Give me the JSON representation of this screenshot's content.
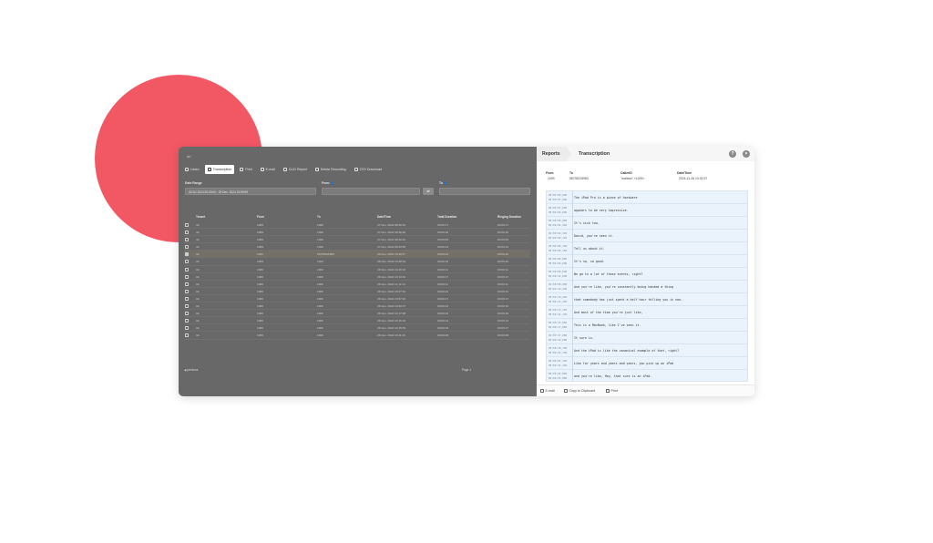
{
  "colors": {
    "accent_circle": "#f25764",
    "main_bg": "#686868",
    "panel_bg": "#ffffff",
    "transcript_bg": "#eaf3fb"
  },
  "breadcrumb": "Ar/",
  "toolbar": [
    {
      "label": "Listen",
      "icon": "headphones-icon",
      "active": false
    },
    {
      "label": "Transcription",
      "icon": "document-icon",
      "active": true
    },
    {
      "label": "Print",
      "icon": "printer-icon",
      "active": false
    },
    {
      "label": "E-mail",
      "icon": "mail-icon",
      "active": false
    },
    {
      "label": "CLID Report",
      "icon": "report-icon",
      "active": false
    },
    {
      "label": "Delete Recording",
      "icon": "trash-icon",
      "active": false
    },
    {
      "label": "CSV Download",
      "icon": "download-icon",
      "active": false
    }
  ],
  "filters": {
    "date_label": "Date Range",
    "date_value": "01/11/ 2024 00:00:00 - 29 Dec. 2024 23:59:59",
    "from_label": "From",
    "from_placeholder": "",
    "to_label": "To",
    "to_placeholder": "",
    "swap": "⇄"
  },
  "table": {
    "headers": [
      "Tenant",
      "From",
      "To",
      "Date/Time",
      "Total Duration",
      "Ringing Duration"
    ],
    "rows": [
      [
        "tttt",
        "1009",
        "1006",
        "27 Nov. 2024 08:39:32",
        "00:00:17",
        "00:00:17"
      ],
      [
        "tttt",
        "1009",
        "1006",
        "27 Nov. 2024 08:38:28",
        "00:00:18",
        "00:00:18"
      ],
      [
        "tttt",
        "1009",
        "1006",
        "27 Nov. 2024 08:30:44",
        "00:00:09",
        "00:00:09"
      ],
      [
        "tttt",
        "1009",
        "1006",
        "27 Nov. 2024 08:23:56",
        "00:00:14",
        "00:00:13"
      ],
      [
        "tttt",
        "1009",
        "58735225983",
        "26 Nov. 2024 16:30:37",
        "00:00:22",
        "00:00:22"
      ],
      [
        "tttt",
        "1009",
        "1004",
        "26 Nov. 2024 13:28:34",
        "00:00:16",
        "00:00:15"
      ],
      [
        "tttt",
        "1009",
        "1004",
        "26 Nov. 2024 13:20:16",
        "00:00:11",
        "00:00:11"
      ],
      [
        "tttt",
        "1009",
        "1006",
        "26 Nov. 2024 13:13:34",
        "00:00:17",
        "00:00:17"
      ],
      [
        "tttt",
        "1009",
        "1006",
        "26 Nov. 2024 11:11:14",
        "00:00:11",
        "00:00:11"
      ],
      [
        "tttt",
        "1009",
        "1006",
        "26 Nov. 2024 10:07:34",
        "00:00:21",
        "00:00:21"
      ],
      [
        "tttt",
        "1009",
        "1006",
        "26 Nov. 2024 10:07:20",
        "00:00:17",
        "00:00:17"
      ],
      [
        "tttt",
        "1009",
        "1006",
        "26 Nov. 2024 10:00:07",
        "00:00:16",
        "00:00:16"
      ],
      [
        "tttt",
        "1009",
        "1006",
        "26 Nov. 2024 10:17:08",
        "00:00:10",
        "00:00:10"
      ],
      [
        "tttt",
        "1009",
        "1006",
        "26 Nov. 2024 10:16:16",
        "00:00:14",
        "00:00:14"
      ],
      [
        "tttt",
        "1009",
        "1006",
        "26 Nov. 2024 10:15:56",
        "00:00:16",
        "00:00:17"
      ],
      [
        "tttt",
        "1009",
        "1006",
        "26 Nov. 2024 10:11:26",
        "00:00:08",
        "00:00:08"
      ]
    ],
    "selected_row": 4
  },
  "pagination": {
    "prev_label": "◀ previous",
    "page_label": "Page 1"
  },
  "panel": {
    "reports_label": "Reports",
    "title": "Transcription",
    "help": "?",
    "close": "×",
    "info": {
      "from_label": "From",
      "from_value": "1009",
      "to_label": "To",
      "to_value": "58735225983",
      "callerid_label": "CallerID",
      "callerid_value": "\"useless\" <1009>",
      "datetime_label": "Date/Time",
      "datetime_value": "2024-11-26 13:30:37"
    },
    "transcript": [
      {
        "start": "00:00:00,000",
        "end": "00:00:07,000",
        "text": "The iPad Pro is a piece of hardware"
      },
      {
        "start": "00:00:07,000",
        "end": "00:00:09,000",
        "text": "appears to be very impressive."
      },
      {
        "start": "00:00:09,000",
        "end": "00:00:04,440",
        "text": "It's sick too."
      },
      {
        "start": "00:00:04,320",
        "end": "00:00:06,320",
        "text": "David, you've seen it."
      },
      {
        "start": "00:00:06,760",
        "end": "00:00:08,760",
        "text": "Tell us about it."
      },
      {
        "start": "00:00:08,880",
        "end": "00:00:09,880",
        "text": "It's so, so good."
      },
      {
        "start": "00:00:09,640",
        "end": "00:00:14,640",
        "text": "We go to a lot of these events, right?"
      },
      {
        "start": "00:00:08,000",
        "end": "00:00:10,440",
        "text": "And you're like, you're constantly being handed a thing"
      },
      {
        "start": "00:00:10,220",
        "end": "00:00:12,320",
        "text": "that somebody has just spent a half hour telling you is new."
      },
      {
        "start": "00:00:13,720",
        "end": "00:00:14,720",
        "text": "And most of the time you're just like,"
      },
      {
        "start": "00:00:15,060",
        "end": "00:00:17,060",
        "text": "This is a MacBook, like I've seen it."
      },
      {
        "start": "00:00:17,080",
        "end": "00:00:18,080",
        "text": "It sure is."
      },
      {
        "start": "00:00:18,700",
        "end": "00:00:22,700",
        "text": "And the iPad is like the canonical example of that, right?"
      },
      {
        "start": "00:00:22,340",
        "end": "00:00:24,340",
        "text": "Like for years and years and years, you pick up an iPad"
      },
      {
        "start": "00:00:24,800",
        "end": "00:00:25,800",
        "text": "and you're like, Hey, that sure is an iPad."
      },
      {
        "start": "00:00:25,760",
        "end": "00:00:27,760",
        "text": ""
      }
    ],
    "footer": [
      {
        "label": "E-mail",
        "icon": "mail-icon"
      },
      {
        "label": "Copy to Clipboard",
        "icon": "copy-icon"
      },
      {
        "label": "Print",
        "icon": "printer-icon"
      }
    ]
  }
}
